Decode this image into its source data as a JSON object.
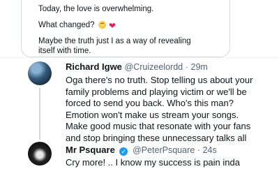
{
  "quoted_tweet": {
    "lines": [
      "Today, the love is overwhelming.",
      "What changed?",
      "Maybe the truth just I as a way of revealing",
      "itself with time."
    ],
    "emoji": [
      "thinking-face",
      "red-heart"
    ]
  },
  "replies": [
    {
      "name": "Richard Igwe",
      "handle": "@Cruizeelordd",
      "separator": "·",
      "time": "29m",
      "body_lines": [
        "Oga there's no truth. Stop telling us about your",
        "family problems and playing victim or we'll be",
        "forced to send you back. Who's this man?",
        "Emotion won't make us stream your songs.",
        "Make good music that resonate with your fans",
        "and stop bringing these unnecessary talks all"
      ]
    },
    {
      "name": "Mr Psquare",
      "verified_mark": "✓",
      "handle": "@PeterPsquare",
      "separator": "·",
      "time": "24s",
      "body_lines": [
        "Cry more! .. I know my success is pain inda"
      ]
    }
  ],
  "colors": {
    "verified": "#1d9bf0",
    "handle": "#536471",
    "border": "#cfd9de"
  }
}
